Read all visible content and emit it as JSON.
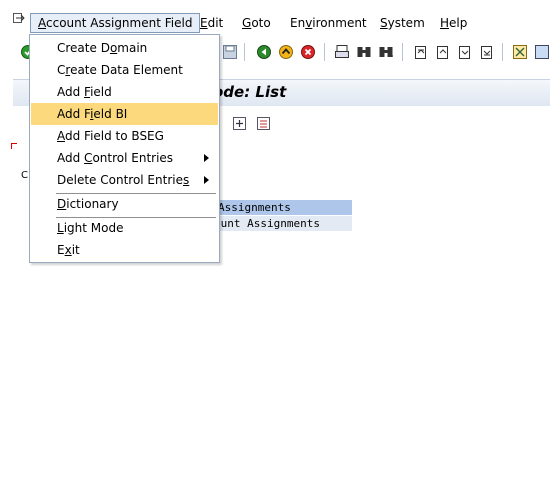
{
  "menubar": {
    "items": [
      {
        "pre": "",
        "acc": "A",
        "post": "ccount Assignment Field"
      },
      {
        "pre": "",
        "acc": "E",
        "post": "dit"
      },
      {
        "pre": "",
        "acc": "G",
        "post": "oto"
      },
      {
        "pre": "En",
        "acc": "v",
        "post": "ironment"
      },
      {
        "pre": "",
        "acc": "S",
        "post": "ystem"
      },
      {
        "pre": "",
        "acc": "H",
        "post": "elp"
      }
    ]
  },
  "title": "ode: List",
  "list": {
    "rows": [
      "Assignments",
      "ount Assignments"
    ]
  },
  "side_label": "C",
  "dropdown": {
    "items": [
      {
        "pre": "Create D",
        "acc": "o",
        "post": "main",
        "submenu": false,
        "highlighted": false
      },
      {
        "pre": "C",
        "acc": "r",
        "post": "eate Data Element",
        "submenu": false,
        "highlighted": false
      },
      {
        "pre": "Add ",
        "acc": "F",
        "post": "ield",
        "submenu": false,
        "highlighted": false
      },
      {
        "pre": "Add F",
        "acc": "i",
        "post": "eld BI",
        "submenu": false,
        "highlighted": true
      },
      {
        "pre": "",
        "acc": "A",
        "post": "dd Field to BSEG",
        "submenu": false,
        "highlighted": false
      },
      {
        "pre": "Add ",
        "acc": "C",
        "post": "ontrol Entries",
        "submenu": true,
        "highlighted": false
      },
      {
        "pre": "Delete Control Entrie",
        "acc": "s",
        "post": "",
        "submenu": true,
        "highlighted": false
      },
      {
        "pre": "",
        "acc": "D",
        "post": "ictionary",
        "submenu": false,
        "highlighted": false
      },
      {
        "pre": "",
        "acc": "L",
        "post": "ight Mode",
        "submenu": false,
        "highlighted": false
      },
      {
        "pre": "E",
        "acc": "x",
        "post": "it",
        "submenu": false,
        "highlighted": false
      }
    ]
  },
  "icons": {
    "system_menu": "system-menu-icon",
    "toolbar": [
      "enter-icon",
      "save-icon",
      "back-icon",
      "exit-icon",
      "cancel-icon",
      "print-icon",
      "find-icon",
      "find-next-icon",
      "first-page-icon",
      "previous-page-icon",
      "next-page-icon",
      "last-page-icon",
      "create-session-icon",
      "help-icon"
    ],
    "app_toolbar": [
      "expand-icon",
      "select-icon"
    ]
  },
  "colors": {
    "highlight": "#fcd97c",
    "selected_row": "#adc6ea",
    "row_alt": "#e4eaf3"
  }
}
